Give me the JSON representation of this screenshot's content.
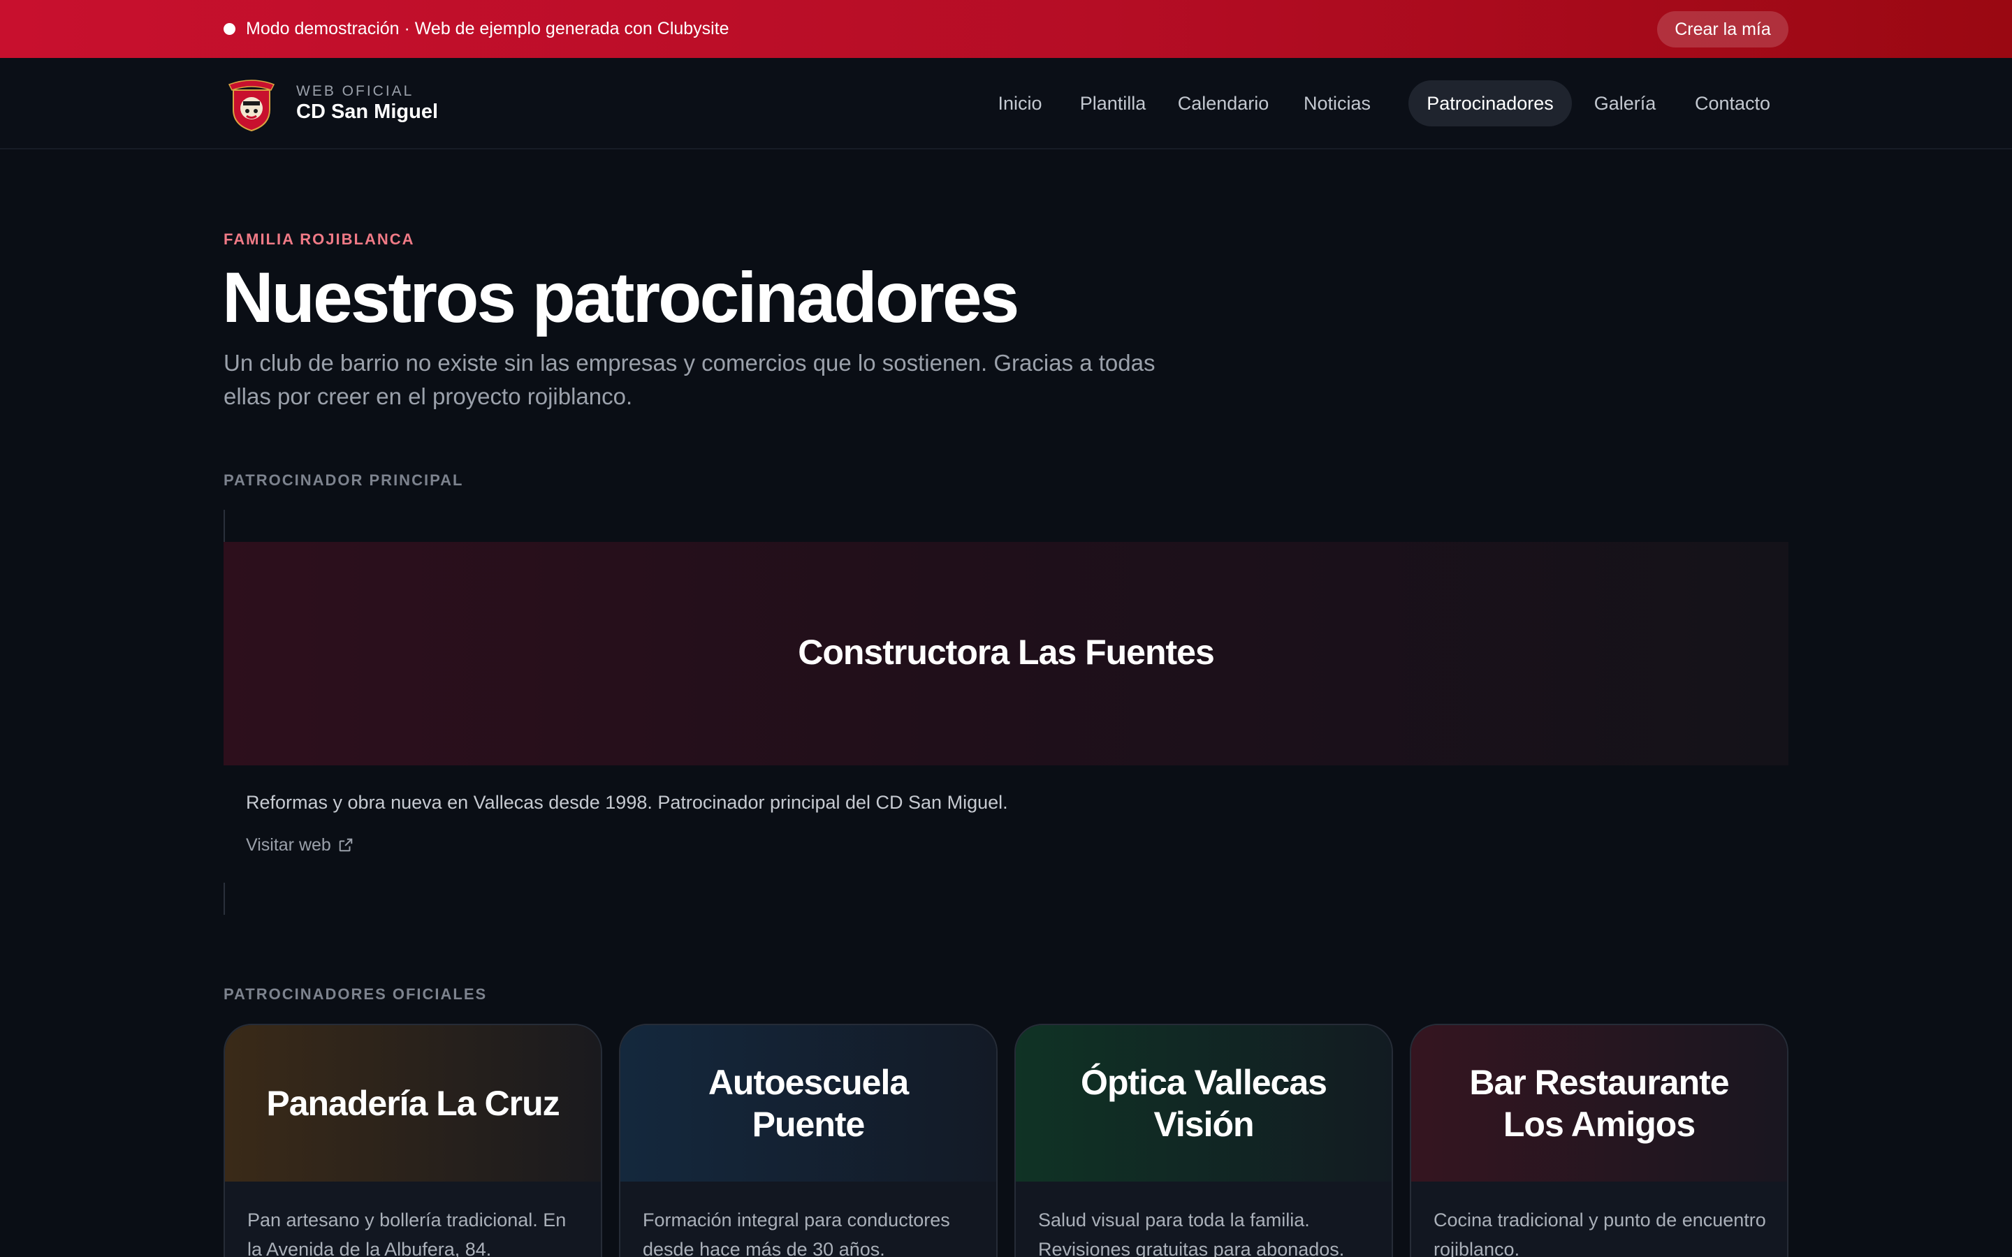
{
  "demo_banner": {
    "text": "Modo demostración · Web de ejemplo generada con Clubysite",
    "cta": "Crear la mía"
  },
  "header": {
    "brand_sub": "WEB OFICIAL",
    "brand_name": "CD San Miguel",
    "nav": [
      {
        "label": "Inicio",
        "active": false
      },
      {
        "label": "Plantilla",
        "active": false
      },
      {
        "label": "Calendario",
        "active": false
      },
      {
        "label": "Noticias",
        "active": false
      },
      {
        "label": "Patrocinadores",
        "active": true
      },
      {
        "label": "Galería",
        "active": false
      },
      {
        "label": "Contacto",
        "active": false
      }
    ]
  },
  "hero": {
    "eyebrow": "FAMILIA ROJIBLANCA",
    "title": "Nuestros patrocinadores",
    "lead": "Un club de barrio no existe sin las empresas y comercios que lo sostienen. Gracias a todas ellas por creer en el proyecto rojiblanco."
  },
  "principal": {
    "section_label": "PATROCINADOR PRINCIPAL",
    "name": "Constructora Las Fuentes",
    "description": "Reformas y obra nueva en Vallecas desde 1998. Patrocinador principal del CD San Miguel.",
    "link_label": "Visitar web"
  },
  "official": {
    "section_label": "PATROCINADORES OFICIALES",
    "sponsors": [
      {
        "name": "Panadería La Cruz",
        "description": "Pan artesano y bollería tradicional. En la Avenida de la Albufera, 84.",
        "tint": "#3a2a18"
      },
      {
        "name": "Autoescuela Puente",
        "description": "Formación integral para conductores desde hace más de 30 años.",
        "tint": "#14283d"
      },
      {
        "name": "Óptica Vallecas Visión",
        "description": "Salud visual para toda la familia. Revisiones gratuitas para abonados.",
        "tint": "#103325"
      },
      {
        "name": "Bar Restaurante Los Amigos",
        "description": "Cocina tradicional y punto de encuentro rojiblanco.",
        "tint": "#351520"
      }
    ]
  },
  "colors": {
    "brand_red": "#c8102e",
    "background": "#0a0e15",
    "eyebrow": "#f07a86"
  }
}
